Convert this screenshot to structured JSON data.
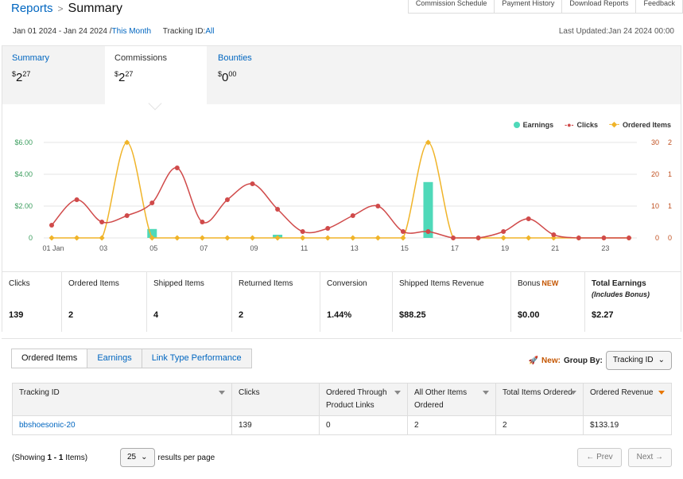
{
  "header": {
    "breadcrumb_root": "Reports",
    "breadcrumb_sep": ">",
    "title": "Summary",
    "top_buttons": [
      "Commission Schedule",
      "Payment History",
      "Download Reports",
      "Feedback"
    ],
    "date_range": "Jan 01 2024 - Jan 24 2024 /",
    "this_month": "This Month",
    "tracking_label": "Tracking ID:",
    "tracking_value": "All",
    "last_updated": "Last Updated:Jan 24 2024 00:00"
  },
  "summary_tabs": [
    {
      "label": "Summary",
      "dollar": "$",
      "whole": "2",
      "cents": "27"
    },
    {
      "label": "Commissions",
      "dollar": "$",
      "whole": "2",
      "cents": "27"
    },
    {
      "label": "Bounties",
      "dollar": "$",
      "whole": "0",
      "cents": "00"
    }
  ],
  "legend": {
    "earnings": "Earnings",
    "clicks": "Clicks",
    "ordered": "Ordered Items"
  },
  "colors": {
    "earnings": "#4fd9b9",
    "clicks": "#d04a4a",
    "ordered": "#f0b429",
    "link": "#0066c0",
    "accent": "#c45500"
  },
  "chart_data": {
    "type": "line",
    "x": [
      "01 Jan",
      "02",
      "03",
      "04",
      "05",
      "06",
      "07",
      "08",
      "09",
      "10",
      "11",
      "12",
      "13",
      "14",
      "15",
      "16",
      "17",
      "18",
      "19",
      "20",
      "21",
      "22",
      "23",
      "24"
    ],
    "x_tick_labels": [
      "01 Jan",
      "03",
      "05",
      "07",
      "09",
      "11",
      "13",
      "15",
      "17",
      "19",
      "21",
      "23"
    ],
    "left_axis_ticks": [
      "$6.00",
      "$4.00",
      "$2.00",
      "0"
    ],
    "right_axis1_ticks": [
      "30",
      "20",
      "10",
      "0"
    ],
    "right_axis2_ticks": [
      "2",
      "1",
      "1",
      "0"
    ],
    "ylim_left": [
      0,
      6
    ],
    "ylim_clicks": [
      0,
      30
    ],
    "ylim_ordered": [
      0,
      2
    ],
    "series": [
      {
        "name": "Earnings",
        "kind": "bar",
        "values": [
          0,
          0,
          0,
          0,
          0.56,
          0,
          0,
          0,
          0,
          0.2,
          0,
          0,
          0,
          0,
          0,
          3.51,
          0,
          0,
          0,
          0,
          0,
          0,
          0,
          0
        ]
      },
      {
        "name": "Clicks",
        "kind": "line",
        "values": [
          4,
          12,
          5,
          7,
          11,
          22,
          5,
          12,
          17,
          9,
          2,
          3,
          7,
          10,
          2,
          2,
          0,
          0,
          2,
          6,
          1,
          0,
          0,
          0
        ]
      },
      {
        "name": "Ordered Items",
        "kind": "line",
        "values": [
          0,
          0,
          0,
          2,
          0,
          0,
          0,
          0,
          0,
          0,
          0,
          0,
          0,
          0,
          0,
          2,
          0,
          0,
          0,
          0,
          0,
          0,
          0,
          0
        ]
      }
    ]
  },
  "metrics": [
    {
      "label": "Clicks",
      "value": "139"
    },
    {
      "label": "Ordered Items",
      "value": "2"
    },
    {
      "label": "Shipped Items",
      "value": "4"
    },
    {
      "label": "Returned Items",
      "value": "2"
    },
    {
      "label": "Conversion",
      "value": "1.44%"
    },
    {
      "label": "Shipped Items Revenue",
      "value": "$88.25"
    },
    {
      "label": "Bonus",
      "new": "NEW",
      "value": "$0.00"
    },
    {
      "label": "Total Earnings",
      "sub": "(Includes Bonus)",
      "value": "$2.27"
    }
  ],
  "lower_tabs": [
    "Ordered Items",
    "Earnings",
    "Link Type Performance"
  ],
  "group_by": {
    "new": "New:",
    "label": "Group By:",
    "value": "Tracking ID"
  },
  "table": {
    "headers": [
      "Tracking ID",
      "Clicks",
      "Ordered Through Product Links",
      "All Other Items Ordered",
      "Total Items Ordered",
      "Ordered Revenue"
    ],
    "rows": [
      [
        "bbshoesonic-20",
        "139",
        "0",
        "2",
        "2",
        "$133.19"
      ]
    ]
  },
  "footer": {
    "showing_prefix": "(Showing ",
    "showing_range": "1 - 1",
    "showing_suffix": " Items)",
    "per_page": "25",
    "per_page_label": "results per page",
    "prev": "Prev",
    "next": "Next"
  }
}
